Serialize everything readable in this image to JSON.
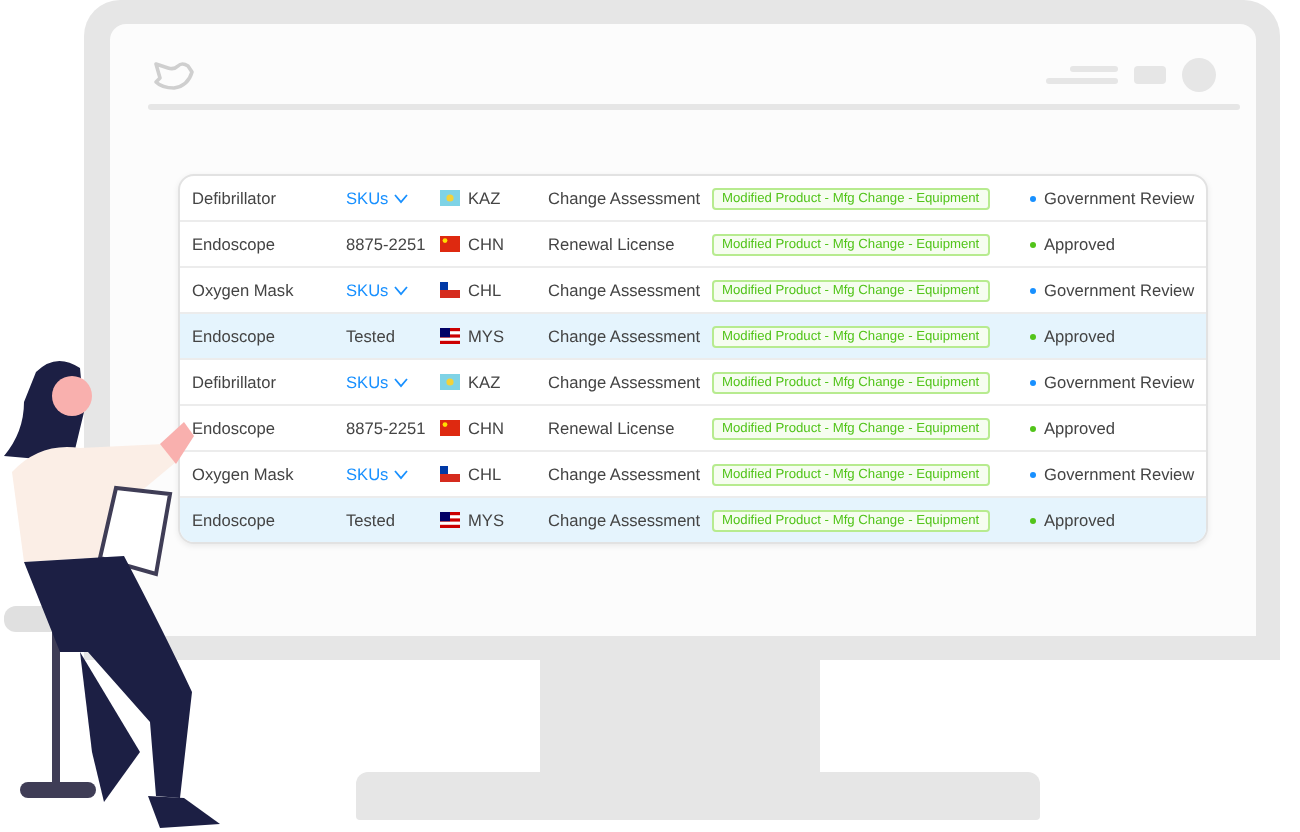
{
  "table": {
    "rows": [
      {
        "product": "Defibrillator",
        "sku": {
          "kind": "dropdown",
          "text": "SKUs"
        },
        "country": {
          "kind": "kz",
          "code": "KAZ"
        },
        "type": "Change Assessment",
        "tag": "Modified Product - Mfg Change - Equipment",
        "status": {
          "text": "Government Review",
          "color": "#1890ff"
        },
        "selected": false
      },
      {
        "product": "Endoscope",
        "sku": {
          "kind": "text",
          "text": "8875-2251"
        },
        "country": {
          "kind": "cn",
          "code": "CHN"
        },
        "type": "Renewal License",
        "tag": "Modified Product - Mfg Change - Equipment",
        "status": {
          "text": "Approved",
          "color": "#52c41a"
        },
        "selected": false
      },
      {
        "product": "Oxygen Mask",
        "sku": {
          "kind": "dropdown",
          "text": "SKUs"
        },
        "country": {
          "kind": "cl",
          "code": "CHL"
        },
        "type": "Change Assessment",
        "tag": "Modified Product - Mfg Change - Equipment",
        "status": {
          "text": "Government Review",
          "color": "#1890ff"
        },
        "selected": false
      },
      {
        "product": "Endoscope",
        "sku": {
          "kind": "text",
          "text": "Tested"
        },
        "country": {
          "kind": "my",
          "code": "MYS"
        },
        "type": "Change Assessment",
        "tag": "Modified Product - Mfg Change - Equipment",
        "status": {
          "text": "Approved",
          "color": "#52c41a"
        },
        "selected": true
      },
      {
        "product": "Defibrillator",
        "sku": {
          "kind": "dropdown",
          "text": "SKUs"
        },
        "country": {
          "kind": "kz",
          "code": "KAZ"
        },
        "type": "Change Assessment",
        "tag": "Modified Product - Mfg Change - Equipment",
        "status": {
          "text": "Government Review",
          "color": "#1890ff"
        },
        "selected": false
      },
      {
        "product": "Endoscope",
        "sku": {
          "kind": "text",
          "text": "8875-2251"
        },
        "country": {
          "kind": "cn",
          "code": "CHN"
        },
        "type": "Renewal License",
        "tag": "Modified Product - Mfg Change - Equipment",
        "status": {
          "text": "Approved",
          "color": "#52c41a"
        },
        "selected": false
      },
      {
        "product": "Oxygen Mask",
        "sku": {
          "kind": "dropdown",
          "text": "SKUs"
        },
        "country": {
          "kind": "cl",
          "code": "CHL"
        },
        "type": "Change Assessment",
        "tag": "Modified Product - Mfg Change - Equipment",
        "status": {
          "text": "Government Review",
          "color": "#1890ff"
        },
        "selected": false
      },
      {
        "product": "Endoscope",
        "sku": {
          "kind": "text",
          "text": "Tested"
        },
        "country": {
          "kind": "my",
          "code": "MYS"
        },
        "type": "Change Assessment",
        "tag": "Modified Product - Mfg Change - Equipment",
        "status": {
          "text": "Approved",
          "color": "#52c41a"
        },
        "selected": true
      }
    ]
  }
}
